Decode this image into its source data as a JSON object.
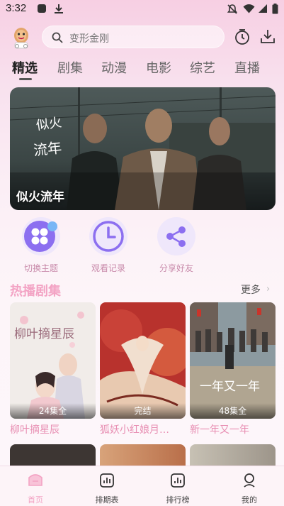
{
  "status_bar": {
    "time": "3:32",
    "left_icons": [
      "notification-icon",
      "download-icon"
    ],
    "right_icons": [
      "mute-icon",
      "wifi-icon",
      "signal-icon",
      "battery-icon"
    ]
  },
  "header": {
    "search_placeholder": "变形金刚",
    "icons": [
      "history-clock-icon",
      "download-icon"
    ]
  },
  "tabs": [
    {
      "label": "精选",
      "active": true
    },
    {
      "label": "剧集",
      "active": false
    },
    {
      "label": "动漫",
      "active": false
    },
    {
      "label": "电影",
      "active": false
    },
    {
      "label": "综艺",
      "active": false
    },
    {
      "label": "直播",
      "active": false
    }
  ],
  "banner": {
    "title": "似火流年",
    "calligraphy": "似火流年"
  },
  "quick_actions": [
    {
      "label": "切换主题",
      "icon": "theme-switch-icon"
    },
    {
      "label": "观看记录",
      "icon": "clock-icon"
    },
    {
      "label": "分享好友",
      "icon": "share-icon"
    }
  ],
  "section": {
    "title": "热播剧集",
    "more_label": "更多",
    "more_arrow": "›"
  },
  "cards": [
    {
      "title": "柳叶摘星辰",
      "badge": "24集全",
      "poster_text": "柳叶摘星辰"
    },
    {
      "title": "狐妖小红娘月…",
      "badge": "完结",
      "poster_text": ""
    },
    {
      "title": "新一年又一年",
      "badge": "48集全",
      "poster_text": "一年又一年"
    }
  ],
  "bottom_nav": [
    {
      "label": "首页",
      "icon": "home-icon",
      "active": true
    },
    {
      "label": "排期表",
      "icon": "schedule-icon",
      "active": false
    },
    {
      "label": "排行榜",
      "icon": "ranking-icon",
      "active": false
    },
    {
      "label": "我的",
      "icon": "profile-icon",
      "active": false
    }
  ],
  "colors": {
    "accent_pink": "#f3a3c4",
    "action_purple": "#8c6ff0",
    "background_top": "#f7cfe3",
    "background_bottom": "#fdf6fa"
  }
}
